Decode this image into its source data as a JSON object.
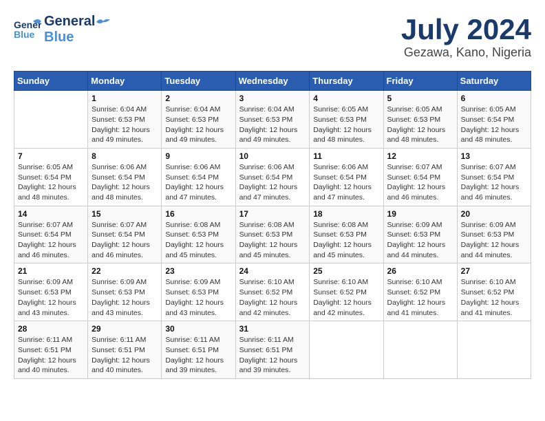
{
  "brand": {
    "name_part1": "General",
    "name_part2": "Blue"
  },
  "title": {
    "month_year": "July 2024",
    "location": "Gezawa, Kano, Nigeria"
  },
  "weekdays": [
    "Sunday",
    "Monday",
    "Tuesday",
    "Wednesday",
    "Thursday",
    "Friday",
    "Saturday"
  ],
  "weeks": [
    [
      {
        "day": "",
        "info": ""
      },
      {
        "day": "1",
        "info": "Sunrise: 6:04 AM\nSunset: 6:53 PM\nDaylight: 12 hours\nand 49 minutes."
      },
      {
        "day": "2",
        "info": "Sunrise: 6:04 AM\nSunset: 6:53 PM\nDaylight: 12 hours\nand 49 minutes."
      },
      {
        "day": "3",
        "info": "Sunrise: 6:04 AM\nSunset: 6:53 PM\nDaylight: 12 hours\nand 49 minutes."
      },
      {
        "day": "4",
        "info": "Sunrise: 6:05 AM\nSunset: 6:53 PM\nDaylight: 12 hours\nand 48 minutes."
      },
      {
        "day": "5",
        "info": "Sunrise: 6:05 AM\nSunset: 6:53 PM\nDaylight: 12 hours\nand 48 minutes."
      },
      {
        "day": "6",
        "info": "Sunrise: 6:05 AM\nSunset: 6:54 PM\nDaylight: 12 hours\nand 48 minutes."
      }
    ],
    [
      {
        "day": "7",
        "info": "Sunrise: 6:05 AM\nSunset: 6:54 PM\nDaylight: 12 hours\nand 48 minutes."
      },
      {
        "day": "8",
        "info": "Sunrise: 6:06 AM\nSunset: 6:54 PM\nDaylight: 12 hours\nand 48 minutes."
      },
      {
        "day": "9",
        "info": "Sunrise: 6:06 AM\nSunset: 6:54 PM\nDaylight: 12 hours\nand 47 minutes."
      },
      {
        "day": "10",
        "info": "Sunrise: 6:06 AM\nSunset: 6:54 PM\nDaylight: 12 hours\nand 47 minutes."
      },
      {
        "day": "11",
        "info": "Sunrise: 6:06 AM\nSunset: 6:54 PM\nDaylight: 12 hours\nand 47 minutes."
      },
      {
        "day": "12",
        "info": "Sunrise: 6:07 AM\nSunset: 6:54 PM\nDaylight: 12 hours\nand 46 minutes."
      },
      {
        "day": "13",
        "info": "Sunrise: 6:07 AM\nSunset: 6:54 PM\nDaylight: 12 hours\nand 46 minutes."
      }
    ],
    [
      {
        "day": "14",
        "info": "Sunrise: 6:07 AM\nSunset: 6:54 PM\nDaylight: 12 hours\nand 46 minutes."
      },
      {
        "day": "15",
        "info": "Sunrise: 6:07 AM\nSunset: 6:54 PM\nDaylight: 12 hours\nand 46 minutes."
      },
      {
        "day": "16",
        "info": "Sunrise: 6:08 AM\nSunset: 6:53 PM\nDaylight: 12 hours\nand 45 minutes."
      },
      {
        "day": "17",
        "info": "Sunrise: 6:08 AM\nSunset: 6:53 PM\nDaylight: 12 hours\nand 45 minutes."
      },
      {
        "day": "18",
        "info": "Sunrise: 6:08 AM\nSunset: 6:53 PM\nDaylight: 12 hours\nand 45 minutes."
      },
      {
        "day": "19",
        "info": "Sunrise: 6:09 AM\nSunset: 6:53 PM\nDaylight: 12 hours\nand 44 minutes."
      },
      {
        "day": "20",
        "info": "Sunrise: 6:09 AM\nSunset: 6:53 PM\nDaylight: 12 hours\nand 44 minutes."
      }
    ],
    [
      {
        "day": "21",
        "info": "Sunrise: 6:09 AM\nSunset: 6:53 PM\nDaylight: 12 hours\nand 43 minutes."
      },
      {
        "day": "22",
        "info": "Sunrise: 6:09 AM\nSunset: 6:53 PM\nDaylight: 12 hours\nand 43 minutes."
      },
      {
        "day": "23",
        "info": "Sunrise: 6:09 AM\nSunset: 6:53 PM\nDaylight: 12 hours\nand 43 minutes."
      },
      {
        "day": "24",
        "info": "Sunrise: 6:10 AM\nSunset: 6:52 PM\nDaylight: 12 hours\nand 42 minutes."
      },
      {
        "day": "25",
        "info": "Sunrise: 6:10 AM\nSunset: 6:52 PM\nDaylight: 12 hours\nand 42 minutes."
      },
      {
        "day": "26",
        "info": "Sunrise: 6:10 AM\nSunset: 6:52 PM\nDaylight: 12 hours\nand 41 minutes."
      },
      {
        "day": "27",
        "info": "Sunrise: 6:10 AM\nSunset: 6:52 PM\nDaylight: 12 hours\nand 41 minutes."
      }
    ],
    [
      {
        "day": "28",
        "info": "Sunrise: 6:11 AM\nSunset: 6:51 PM\nDaylight: 12 hours\nand 40 minutes."
      },
      {
        "day": "29",
        "info": "Sunrise: 6:11 AM\nSunset: 6:51 PM\nDaylight: 12 hours\nand 40 minutes."
      },
      {
        "day": "30",
        "info": "Sunrise: 6:11 AM\nSunset: 6:51 PM\nDaylight: 12 hours\nand 39 minutes."
      },
      {
        "day": "31",
        "info": "Sunrise: 6:11 AM\nSunset: 6:51 PM\nDaylight: 12 hours\nand 39 minutes."
      },
      {
        "day": "",
        "info": ""
      },
      {
        "day": "",
        "info": ""
      },
      {
        "day": "",
        "info": ""
      }
    ]
  ]
}
